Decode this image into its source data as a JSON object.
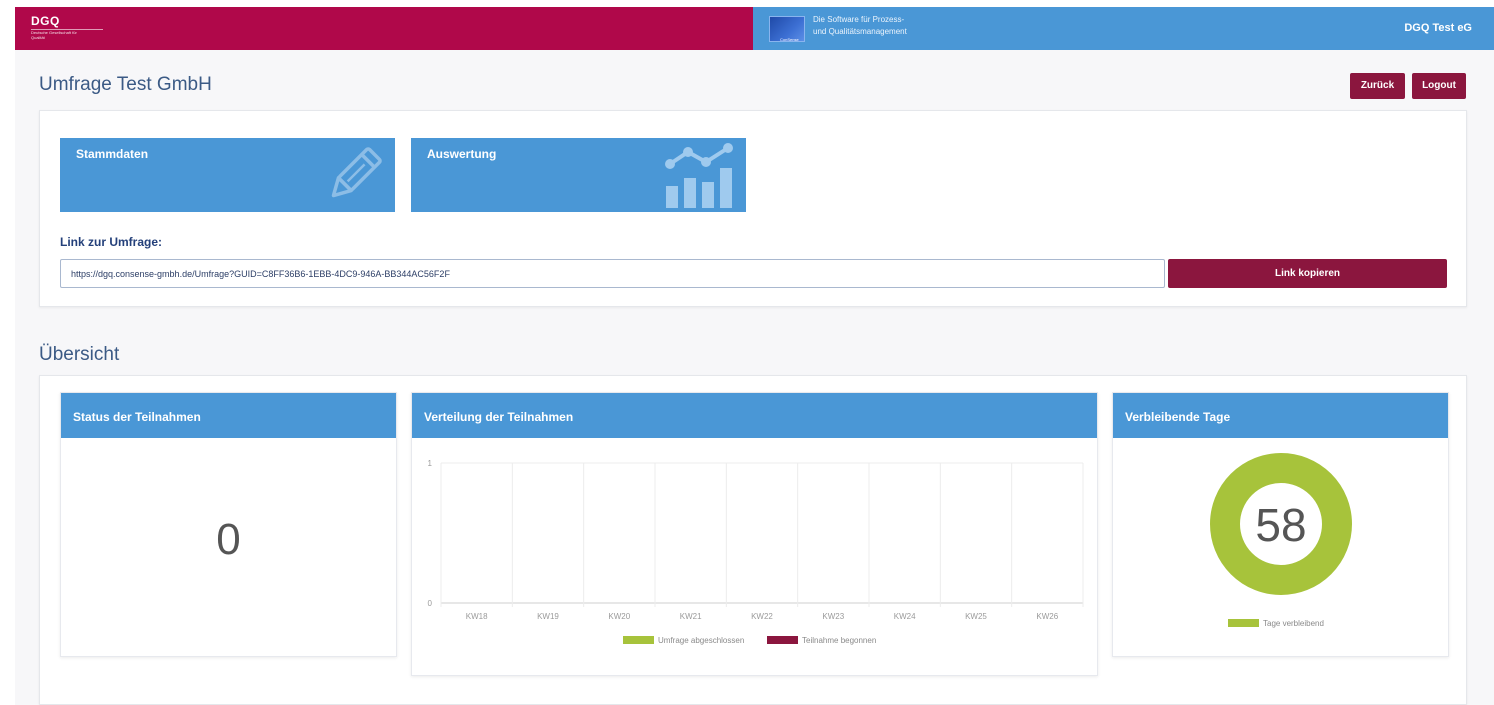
{
  "header": {
    "logo_text": "DGQ",
    "logo_subtext": "Deutsche Gesellschaft für Qualität",
    "software_logo_text": "ConSense",
    "tagline_line1": "Die Software für Prozess-",
    "tagline_line2": "und Qualitätsmanagement",
    "org_name": "DGQ Test eG",
    "colors": {
      "left": "#b0084a",
      "right": "#4a97d6"
    }
  },
  "page": {
    "title": "Umfrage Test GmbH",
    "back_label": "Zurück",
    "logout_label": "Logout"
  },
  "tiles": [
    {
      "label": "Stammdaten",
      "icon": "pencil-icon"
    },
    {
      "label": "Auswertung",
      "icon": "chart-icon"
    }
  ],
  "link": {
    "label": "Link zur Umfrage:",
    "url": "https://dgq.consense-gmbh.de/Umfrage?GUID=C8FF36B6-1EBB-4DC9-946A-BB344AC56F2F",
    "copy_label": "Link kopieren"
  },
  "overview": {
    "title": "Übersicht",
    "status_panel": {
      "title": "Status der Teilnahmen",
      "value": "0"
    },
    "distribution_panel": {
      "title": "Verteilung der Teilnahmen"
    },
    "days_panel": {
      "title": "Verbleibende Tage",
      "value": "58"
    }
  },
  "chart_data": [
    {
      "type": "bar",
      "categories": [
        "KW18",
        "KW19",
        "KW20",
        "KW21",
        "KW22",
        "KW23",
        "KW24",
        "KW25",
        "KW26"
      ],
      "series": [
        {
          "name": "Umfrage abgeschlossen",
          "color": "#a7c33b",
          "values": [
            0,
            0,
            0,
            0,
            0,
            0,
            0,
            0,
            0
          ]
        },
        {
          "name": "Teilnahme begonnen",
          "color": "#8b163e",
          "values": [
            0,
            0,
            0,
            0,
            0,
            0,
            0,
            0,
            0
          ]
        }
      ],
      "ylim": [
        0,
        1
      ],
      "yticks": [
        "0",
        "1"
      ],
      "grid": true,
      "legend": "bottom"
    },
    {
      "type": "pie",
      "donut": true,
      "center_label": "58",
      "slices": [
        {
          "name": "Tage verbleibend",
          "value": 58,
          "color": "#a7c33b"
        }
      ],
      "legend": "bottom"
    }
  ]
}
